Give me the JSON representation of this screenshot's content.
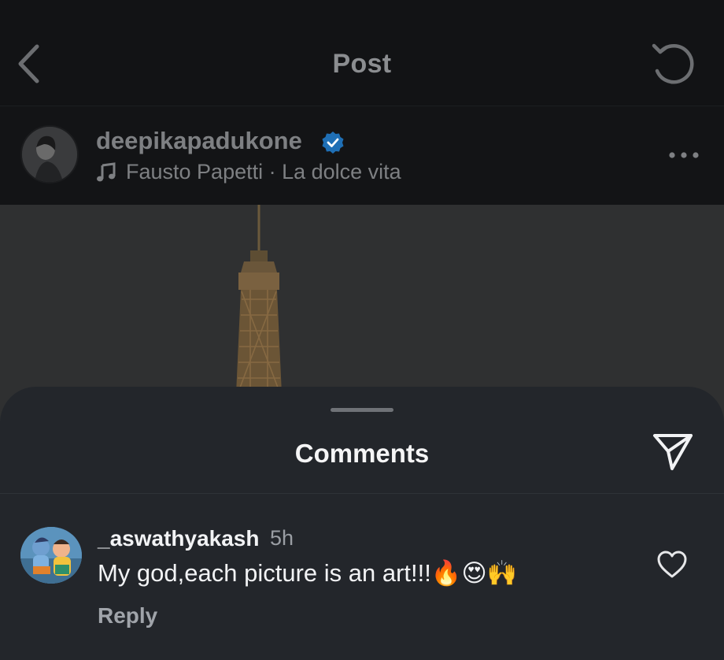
{
  "nav": {
    "title": "Post",
    "back_icon": "chevron-left-icon",
    "refresh_icon": "refresh-icon"
  },
  "post": {
    "username": "deepikapadukone",
    "verified_icon": "verified-badge-icon",
    "audio_icon": "music-note-icon",
    "audio": "Fausto Papetti · La dolce vita",
    "more_icon": "more-horizontal-icon"
  },
  "comments_sheet": {
    "title": "Comments",
    "share_icon": "send-icon",
    "comments": [
      {
        "username": "_aswathyakash",
        "time": "5h",
        "text": "My god,each picture is an art!!!🔥😍🙌",
        "reply_label": "Reply",
        "like_icon": "heart-outline-icon"
      }
    ]
  },
  "colors": {
    "background": "#131416",
    "sheet": "#23262b",
    "verified_blue": "#0095f6",
    "muted_text": "#7e8083"
  }
}
